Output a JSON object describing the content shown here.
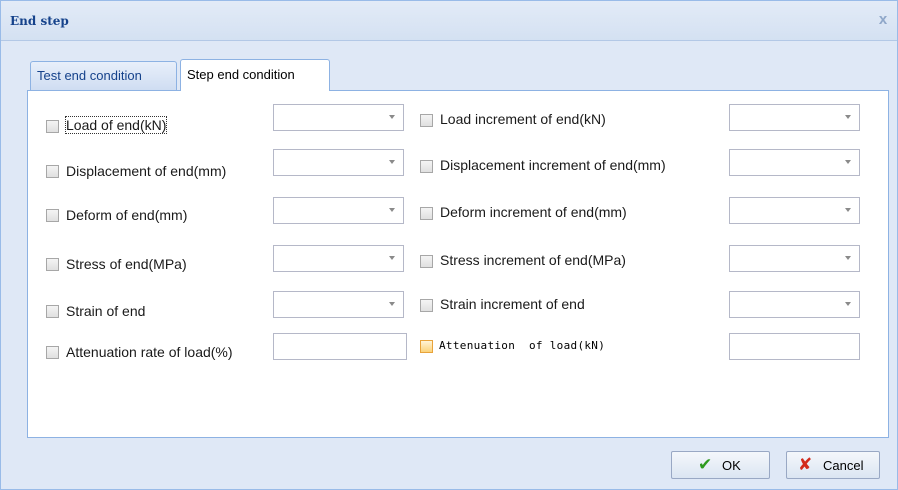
{
  "window": {
    "title": "End step",
    "close_glyph": "x"
  },
  "tabs": [
    {
      "label": "Test end condition",
      "active": false
    },
    {
      "label": "Step end condition",
      "active": true
    }
  ],
  "left_fields": [
    {
      "label": "Load of end(kN)",
      "kind": "combo",
      "value": "",
      "checked": false
    },
    {
      "label": "Displacement of end(mm)",
      "kind": "combo",
      "value": "",
      "checked": false
    },
    {
      "label": "Deform of end(mm)",
      "kind": "combo",
      "value": "",
      "checked": false
    },
    {
      "label": "Stress of end(MPa)",
      "kind": "combo",
      "value": "",
      "checked": false
    },
    {
      "label": "Strain of end",
      "kind": "combo",
      "value": "",
      "checked": false
    },
    {
      "label": "Attenuation rate of load(%)",
      "kind": "text",
      "value": "",
      "checked": false
    }
  ],
  "right_fields": [
    {
      "label": "Load increment of end(kN)",
      "kind": "combo",
      "value": "",
      "checked": false
    },
    {
      "label": "Displacement increment of end(mm)",
      "kind": "combo",
      "value": "",
      "checked": false
    },
    {
      "label": "Deform increment of end(mm)",
      "kind": "combo",
      "value": "",
      "checked": false
    },
    {
      "label": "Stress increment of end(MPa)",
      "kind": "combo",
      "value": "",
      "checked": false
    },
    {
      "label": "Strain increment of end",
      "kind": "combo",
      "value": "",
      "checked": false
    },
    {
      "label": "Attenuation  of load(kN)",
      "kind": "text",
      "value": "",
      "checked": false
    }
  ],
  "buttons": {
    "ok_label": "OK",
    "cancel_label": "Cancel"
  },
  "icons": {
    "ok": "check-icon",
    "cancel": "cross-icon"
  },
  "colors": {
    "title_text": "#15428b",
    "ok_check": "#2e9a1e",
    "cancel_cross": "#d32a1b",
    "highlight_checkbox": "#fbd27a"
  }
}
